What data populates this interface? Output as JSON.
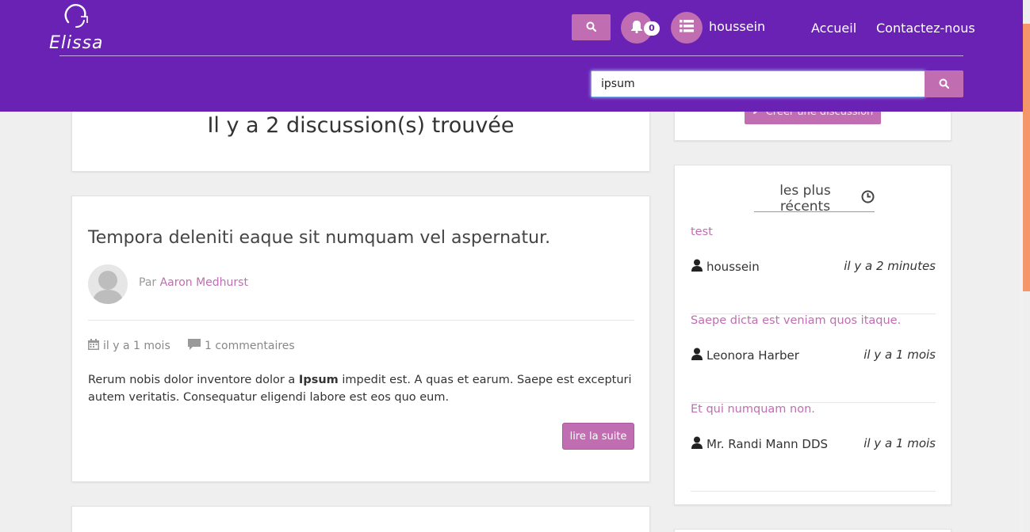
{
  "header": {
    "logo_text": "Elissa",
    "notification_count": "0",
    "username": "houssein",
    "nav": [
      "Accueil",
      "Contactez-nous"
    ],
    "search_value": "ipsum",
    "colors": {
      "primary": "#6a22b4",
      "accent": "#c06db2"
    }
  },
  "results": {
    "title": "Il y a 2 discussion(s) trouvée"
  },
  "post": {
    "title": "Tempora deleniti eaque sit numquam vel aspernatur.",
    "author_prefix": "Par",
    "author": "Aaron Medhurst",
    "date": "il y a 1 mois",
    "comments": "1 commentaires",
    "body_before": "Rerum nobis dolor inventore dolor a ",
    "body_highlight": "Ipsum",
    "body_after": " impedit est. A quas et earum. Saepe est excepturi autem veritatis. Consequatur eligendi labore est eos quo eum.",
    "read_more": "lire la suite"
  },
  "sidebar": {
    "create_label": "Créer une discussion",
    "recent_title": "les plus récents",
    "recent": [
      {
        "title": "test",
        "author": "houssein",
        "time": "il y a 2 minutes"
      },
      {
        "title": "Saepe dicta est veniam quos itaque.",
        "author": "Leonora Harber",
        "time": "il y a 1 mois"
      },
      {
        "title": "Et qui numquam non.",
        "author": "Mr. Randi Mann DDS",
        "time": "il y a 1 mois"
      }
    ]
  },
  "icons": [
    "search-icon",
    "bell-icon",
    "list-icon",
    "calendar-icon",
    "comment-icon",
    "user-icon",
    "clock-icon",
    "pencil-icon"
  ]
}
